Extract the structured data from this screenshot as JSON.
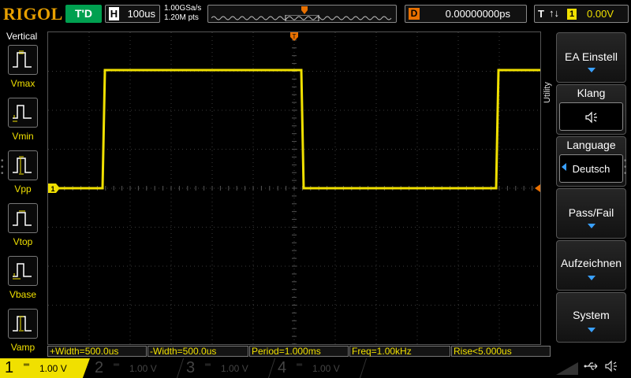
{
  "header": {
    "brand": "RIGOL",
    "run_status": "T'D",
    "horizontal_key": "H",
    "timebase": "100us",
    "sample_rate": "1.00GSa/s",
    "memory_depth": "1.20M pts",
    "delay_key": "D",
    "delay_value": "0.00000000ps",
    "trigger_key": "T",
    "trigger_edge_symbol": "↑↓",
    "trigger_source": "1",
    "trigger_level": "0.00V"
  },
  "left_panel": {
    "title": "Vertical",
    "items": [
      {
        "label": "Vmax",
        "icon": "vmax-icon"
      },
      {
        "label": "Vmin",
        "icon": "vmin-icon"
      },
      {
        "label": "Vpp",
        "icon": "vpp-icon"
      },
      {
        "label": "Vtop",
        "icon": "vtop-icon"
      },
      {
        "label": "Vbase",
        "icon": "vbase-icon"
      },
      {
        "label": "Vamp",
        "icon": "vamp-icon"
      }
    ]
  },
  "right_menu": {
    "section_title": "Utility",
    "items": [
      {
        "label": "EA Einstell",
        "type": "submenu"
      },
      {
        "label": "Klang",
        "type": "value",
        "value_icon": "speaker-icon",
        "value": "🔈"
      },
      {
        "label": "Language",
        "type": "value",
        "value": "Deutsch"
      },
      {
        "label": "Pass/Fail",
        "type": "submenu"
      },
      {
        "label": "Aufzeichnen",
        "type": "submenu"
      },
      {
        "label": "System",
        "type": "submenu"
      }
    ]
  },
  "waveform": {
    "channel_marker": "1",
    "trigger_marker": "T",
    "colors": {
      "trace": "#f0e000",
      "grid": "#3a3a3a",
      "trigger": "#e87000"
    }
  },
  "measurements": [
    "+Width=500.0us",
    "-Width=500.0us",
    "Period=1.000ms",
    "Freq=1.00kHz",
    "Rise<5.000us"
  ],
  "channels": [
    {
      "number": "1",
      "coupling": "═",
      "scale": "1.00 V",
      "active": true
    },
    {
      "number": "2",
      "coupling": "═",
      "scale": "1.00 V",
      "active": false
    },
    {
      "number": "3",
      "coupling": "═",
      "scale": "1.00 V",
      "active": false
    },
    {
      "number": "4",
      "coupling": "═",
      "scale": "1.00 V",
      "active": false
    }
  ],
  "status_icons": {
    "usb": "⮂",
    "sound": "🔈"
  }
}
